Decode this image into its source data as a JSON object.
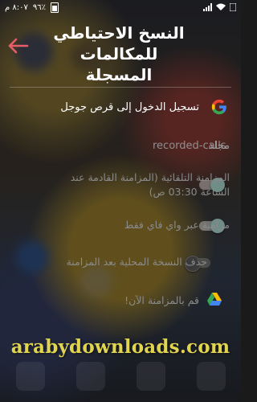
{
  "status_bar": {
    "time": "٨:٠٧ م",
    "battery": "٩٦٪"
  },
  "header": {
    "title": "النسخ الاحتياطي للمكالمات المسجلة"
  },
  "settings": {
    "google_signin": "تسجيل الدخول إلى قرص جوجل",
    "folder_label": "مجلد",
    "folder_value": "recorded-calls",
    "auto_sync": "المزامنة التلقائية (المزامنة القادمة عند الساعة 03:30 ص)",
    "wifi_only": "مزامنة عبر واي فاي فقط",
    "delete_local": "حذف النسخة المحلية بعد المزامنة",
    "sync_now": "قم بالمزامنة الآن!"
  },
  "toggles": {
    "auto_sync_on": true,
    "wifi_only_on": true,
    "delete_local_on": false
  },
  "watermark": "arabydownloads.com",
  "colors": {
    "accent_back": "#e85d6a",
    "watermark": "#e1d44f"
  },
  "icons": [
    "back-arrow-icon",
    "google-icon",
    "google-drive-icon",
    "wifi-icon",
    "signal-icon",
    "battery-icon"
  ]
}
